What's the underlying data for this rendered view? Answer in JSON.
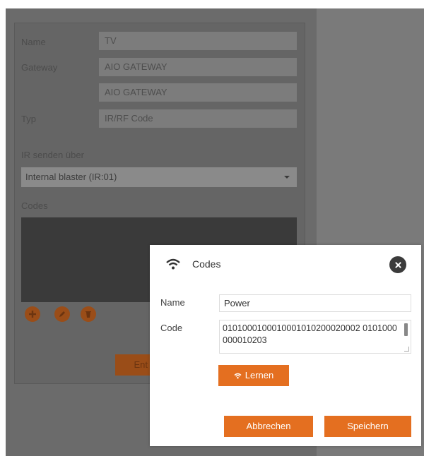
{
  "background_form": {
    "name_label": "Name",
    "name_value": "TV",
    "gateway_label": "Gateway",
    "gateway_value_1": "AIO GATEWAY",
    "gateway_value_2": "AIO GATEWAY",
    "type_label": "Typ",
    "type_value": "IR/RF Code",
    "ir_send_label": "IR senden über",
    "ir_send_selected": "Internal blaster (IR:01)",
    "codes_label": "Codes",
    "partial_button_label": "Ent"
  },
  "dialog": {
    "title": "Codes",
    "name_label": "Name",
    "name_value": "Power",
    "code_label": "Code",
    "code_value": "0101000100010001010200020002 0101000000010203",
    "learn_button": "Lernen",
    "cancel_button": "Abbrechen",
    "save_button": "Speichern"
  },
  "colors": {
    "accent": "#e46f20",
    "backdrop": "#7a7a7a",
    "close_icon": "#3b3b3b"
  }
}
